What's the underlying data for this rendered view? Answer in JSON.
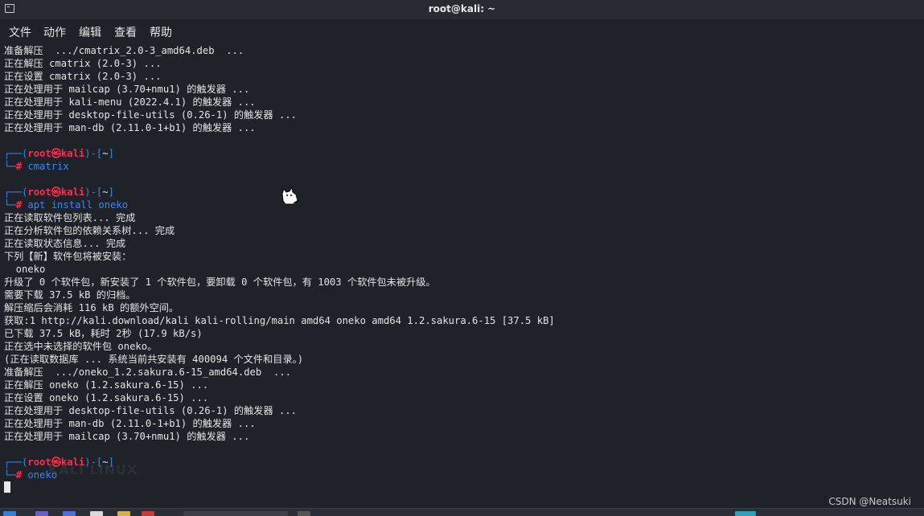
{
  "window": {
    "title": "root@kali: ~"
  },
  "menu": [
    "文件",
    "动作",
    "编辑",
    "查看",
    "帮助"
  ],
  "terminal_lines": [
    {
      "type": "out",
      "text": "准备解压  .../cmatrix_2.0-3_amd64.deb  ..."
    },
    {
      "type": "out",
      "text": "正在解压 cmatrix (2.0-3) ..."
    },
    {
      "type": "out",
      "text": "正在设置 cmatrix (2.0-3) ..."
    },
    {
      "type": "out",
      "text": "正在处理用于 mailcap (3.70+nmu1) 的触发器 ..."
    },
    {
      "type": "out",
      "text": "正在处理用于 kali-menu (2022.4.1) 的触发器 ..."
    },
    {
      "type": "out",
      "text": "正在处理用于 desktop-file-utils (0.26-1) 的触发器 ..."
    },
    {
      "type": "out",
      "text": "正在处理用于 man-db (2.11.0-1+b1) 的触发器 ..."
    },
    {
      "type": "blank",
      "text": ""
    },
    {
      "type": "prompt",
      "a": "┌──(",
      "user": "root㉿kali",
      "b": ")-[",
      "dir": "~",
      "c": "]"
    },
    {
      "type": "cmd",
      "prefix": "└─",
      "hash": "#",
      "text": " cmatrix"
    },
    {
      "type": "blank",
      "text": ""
    },
    {
      "type": "prompt",
      "a": "┌──(",
      "user": "root㉿kali",
      "b": ")-[",
      "dir": "~",
      "c": "]"
    },
    {
      "type": "cmd",
      "prefix": "└─",
      "hash": "#",
      "text": " apt install oneko"
    },
    {
      "type": "out",
      "text": "正在读取软件包列表... 完成"
    },
    {
      "type": "out",
      "text": "正在分析软件包的依赖关系树... 完成"
    },
    {
      "type": "out",
      "text": "正在读取状态信息... 完成"
    },
    {
      "type": "out",
      "text": "下列【新】软件包将被安装："
    },
    {
      "type": "out",
      "text": "  oneko"
    },
    {
      "type": "out",
      "text": "升级了 0 个软件包，新安装了 1 个软件包，要卸载 0 个软件包，有 1003 个软件包未被升级。"
    },
    {
      "type": "out",
      "text": "需要下载 37.5 kB 的归档。"
    },
    {
      "type": "out",
      "text": "解压缩后会消耗 116 kB 的额外空间。"
    },
    {
      "type": "out",
      "text": "获取:1 http://kali.download/kali kali-rolling/main amd64 oneko amd64 1.2.sakura.6-15 [37.5 kB]"
    },
    {
      "type": "out",
      "text": "已下载 37.5 kB，耗时 2秒 (17.9 kB/s)"
    },
    {
      "type": "out",
      "text": "正在选中未选择的软件包 oneko。"
    },
    {
      "type": "out",
      "text": "(正在读取数据库 ... 系统当前共安装有 400094 个文件和目录。)"
    },
    {
      "type": "out",
      "text": "准备解压  .../oneko_1.2.sakura.6-15_amd64.deb  ..."
    },
    {
      "type": "out",
      "text": "正在解压 oneko (1.2.sakura.6-15) ..."
    },
    {
      "type": "out",
      "text": "正在设置 oneko (1.2.sakura.6-15) ..."
    },
    {
      "type": "out",
      "text": "正在处理用于 desktop-file-utils (0.26-1) 的触发器 ..."
    },
    {
      "type": "out",
      "text": "正在处理用于 man-db (2.11.0-1+b1) 的触发器 ..."
    },
    {
      "type": "out",
      "text": "正在处理用于 mailcap (3.70+nmu1) 的触发器 ..."
    },
    {
      "type": "blank",
      "text": ""
    },
    {
      "type": "prompt",
      "a": "┌──(",
      "user": "root㉿kali",
      "b": ")-[",
      "dir": "~",
      "c": "]"
    },
    {
      "type": "cmd",
      "prefix": "└─",
      "hash": "#",
      "text": " oneko"
    },
    {
      "type": "cursor",
      "text": ""
    }
  ],
  "watermark_text": "KALI LINUX",
  "credit": "CSDN @Neatsuki",
  "colors": {
    "prompt_frame": "#3d86e8",
    "prompt_user": "#ff2e4d",
    "background": "#1f2229",
    "text": "#e4e4e4"
  }
}
